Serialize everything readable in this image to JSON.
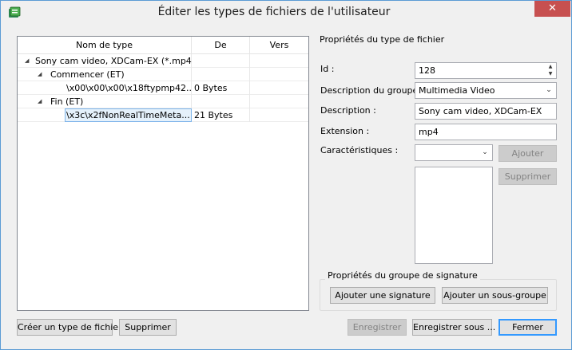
{
  "window": {
    "title": "Éditer les types de fichiers de l'utilisateur",
    "close_glyph": "✕"
  },
  "tree": {
    "columns": [
      "Nom de type",
      "De",
      "Vers"
    ],
    "rows": [
      {
        "name": "Sony cam video, XDCam-EX (*.mp4)",
        "de": "",
        "vers": "",
        "arrow": "◢"
      },
      {
        "name": "Commencer (ET)",
        "de": "",
        "vers": "",
        "arrow": "◢"
      },
      {
        "name": "\\x00\\x00\\x00\\x18ftypmp42...",
        "de": "0 Bytes",
        "vers": ""
      },
      {
        "name": "Fin (ET)",
        "de": "",
        "vers": "",
        "arrow": "◢"
      },
      {
        "name": "\\x3c\\x2fNonRealTimeMeta...",
        "de": "21 Bytes",
        "vers": ""
      }
    ]
  },
  "props": {
    "section_title": "Propriétés du type de fichier",
    "id_label": "Id :",
    "id_value": "128",
    "group_label": "Description du groupe :",
    "group_value": "Multimedia Video",
    "desc_label": "Description :",
    "desc_value": "Sony cam video, XDCam-EX",
    "ext_label": "Extension :",
    "ext_value": "mp4",
    "char_label": "Caractéristiques :",
    "char_value": "",
    "add_label": "Ajouter",
    "remove_label": "Supprimer"
  },
  "signature_group": {
    "title": "Propriétés du groupe de signature",
    "add_signature": "Ajouter une signature",
    "add_subgroup": "Ajouter un sous-groupe"
  },
  "footer": {
    "create_type": "Créer un type de fichier",
    "delete": "Supprimer",
    "save": "Enregistrer",
    "save_as": "Enregistrer sous ...",
    "close": "Fermer"
  },
  "icons": {
    "spin_up": "▲",
    "spin_down": "▼",
    "dropdown": "⌄"
  },
  "colors": {
    "close_button": "#c75050",
    "selection_border": "#7eb4ea",
    "focus_border": "#3399ff"
  }
}
